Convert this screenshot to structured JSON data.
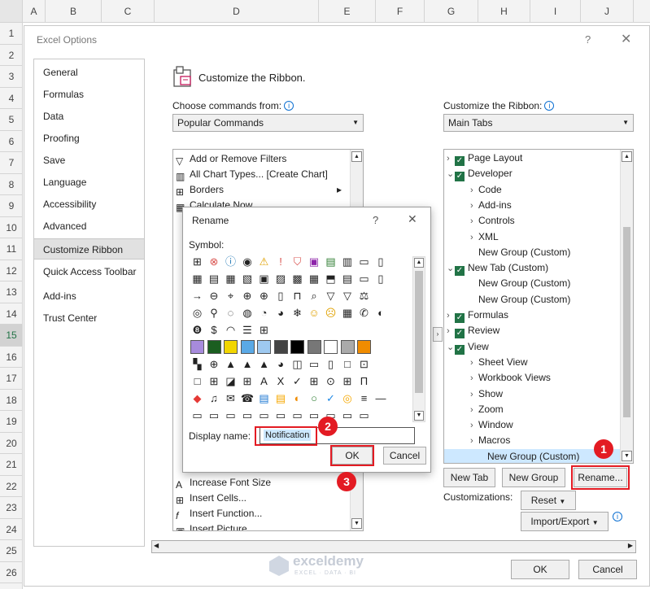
{
  "columns": [
    "A",
    "B",
    "C",
    "D",
    "E",
    "F",
    "G",
    "H",
    "I",
    "J"
  ],
  "rows": [
    "1",
    "2",
    "3",
    "4",
    "5",
    "6",
    "7",
    "8",
    "9",
    "10",
    "11",
    "12",
    "13",
    "14",
    "15",
    "16",
    "17",
    "18",
    "19",
    "20",
    "21",
    "22",
    "23",
    "24",
    "25",
    "26"
  ],
  "options": {
    "title": "Excel Options",
    "help": "?",
    "close": "✕",
    "nav": [
      "General",
      "Formulas",
      "Data",
      "Proofing",
      "Save",
      "Language",
      "Accessibility",
      "Advanced",
      "Customize Ribbon",
      "Quick Access Toolbar",
      "Add-ins",
      "Trust Center"
    ],
    "selected_nav": "Customize Ribbon",
    "page_title": "Customize the Ribbon.",
    "choose_label": "Choose commands from:",
    "choose_value": "Popular Commands",
    "customize_label": "Customize the Ribbon:",
    "customize_value": "Main Tabs",
    "commands": [
      "Add or Remove Filters",
      "All Chart Types... [Create Chart]",
      "Borders",
      "Calculate Now",
      "Increase Font Size",
      "Insert Cells...",
      "Insert Function...",
      "Insert Picture"
    ],
    "tree": [
      {
        "label": "Page Layout",
        "level": 0,
        "checked": true,
        "expander": "›"
      },
      {
        "label": "Developer",
        "level": 0,
        "checked": true,
        "expander": "⌄"
      },
      {
        "label": "Code",
        "level": 1,
        "expander": "›"
      },
      {
        "label": "Add-ins",
        "level": 1,
        "expander": "›"
      },
      {
        "label": "Controls",
        "level": 1,
        "expander": "›"
      },
      {
        "label": "XML",
        "level": 1,
        "expander": "›"
      },
      {
        "label": "New Group (Custom)",
        "level": 1,
        "expander": ""
      },
      {
        "label": "New Tab (Custom)",
        "level": 0,
        "checked": true,
        "expander": "⌄"
      },
      {
        "label": "New Group (Custom)",
        "level": 1,
        "expander": ""
      },
      {
        "label": "New Group (Custom)",
        "level": 1,
        "expander": ""
      },
      {
        "label": "Formulas",
        "level": 0,
        "checked": true,
        "expander": "›"
      },
      {
        "label": "Review",
        "level": 0,
        "checked": true,
        "expander": "›"
      },
      {
        "label": "View",
        "level": 0,
        "checked": true,
        "expander": "⌄"
      },
      {
        "label": "Sheet View",
        "level": 1,
        "expander": "›"
      },
      {
        "label": "Workbook Views",
        "level": 1,
        "expander": "›"
      },
      {
        "label": "Show",
        "level": 1,
        "expander": "›"
      },
      {
        "label": "Zoom",
        "level": 1,
        "expander": "›"
      },
      {
        "label": "Window",
        "level": 1,
        "expander": "›"
      },
      {
        "label": "Macros",
        "level": 1,
        "expander": "›"
      },
      {
        "label": "New Group (Custom)",
        "level": 1,
        "expander": "",
        "selected": true
      }
    ],
    "new_tab": "New Tab",
    "new_group": "New Group",
    "rename": "Rename...",
    "customizations": "Customizations:",
    "reset": "Reset",
    "import_export": "Import/Export",
    "ok": "OK",
    "cancel": "Cancel"
  },
  "rename_dialog": {
    "title": "Rename",
    "help": "?",
    "close": "✕",
    "symbol_label": "Symbol:",
    "display_label": "Display name:",
    "display_value": "Notification",
    "ok": "OK",
    "cancel": "Cancel"
  },
  "badges": [
    "1",
    "2",
    "3"
  ],
  "watermark": {
    "brand": "exceldemy",
    "tagline": "EXCEL · DATA · BI"
  },
  "colors": {
    "accent": "#217346",
    "highlight": "#e31b23",
    "selected_row": "#cde8ff"
  }
}
